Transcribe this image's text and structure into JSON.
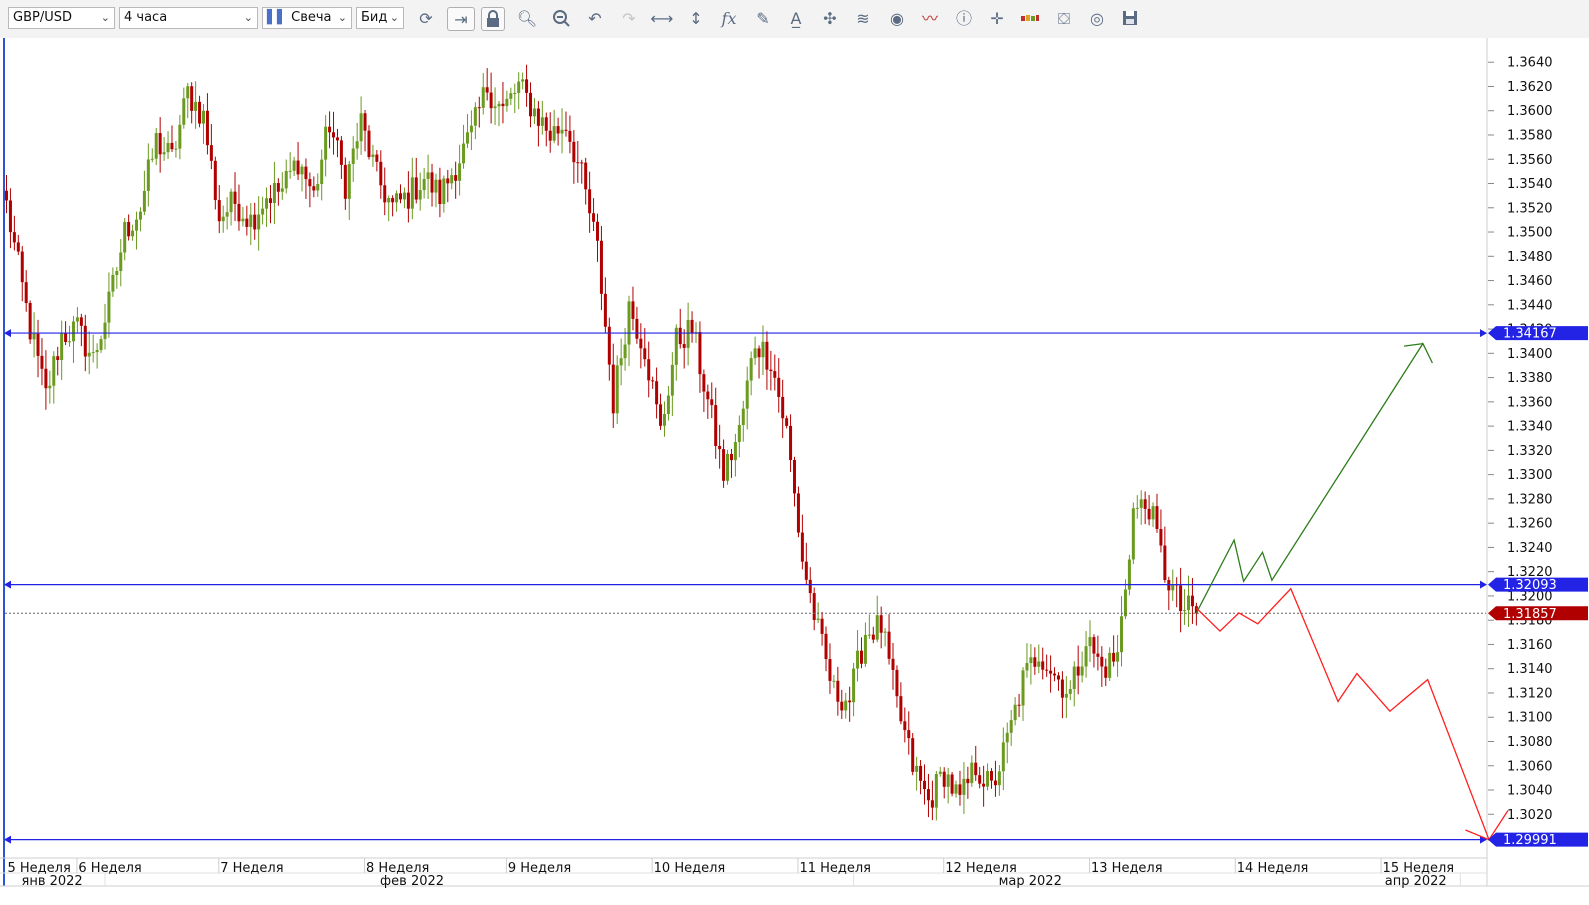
{
  "toolbar": {
    "symbol": "GBP/USD",
    "timeframe": "4 часа",
    "chart_type": "Свеча",
    "price_side": "Бид",
    "icons": [
      "refresh-icon",
      "auto-scroll-icon",
      "lock-icon",
      "zoom-in-icon",
      "zoom-out-icon",
      "undo-icon",
      "redo-icon",
      "horizontal-scale-icon",
      "vertical-scale-icon",
      "indicators-fx-icon",
      "pencil-icon",
      "text-tool-icon",
      "pattern-icon",
      "layers-icon",
      "eye-icon",
      "signals-icon",
      "info-icon",
      "crosshair-icon",
      "volume-bar-icon",
      "paint-bucket-icon",
      "template-icon",
      "save-icon"
    ]
  },
  "colors": {
    "bull": "#6a9a1f",
    "bear": "#b00000",
    "level_line": "#2323e6",
    "green_arrow": "#2e7d1b",
    "red_arrow": "#ff2020",
    "current_price": "#b00000"
  },
  "chart_data": {
    "type": "candlestick",
    "ylim": [
      1.2982,
      1.3655
    ],
    "yticks": [
      1.302,
      1.304,
      1.306,
      1.308,
      1.31,
      1.312,
      1.314,
      1.316,
      1.318,
      1.32,
      1.322,
      1.324,
      1.326,
      1.328,
      1.33,
      1.332,
      1.334,
      1.336,
      1.338,
      1.34,
      1.342,
      1.344,
      1.346,
      1.348,
      1.35,
      1.352,
      1.354,
      1.356,
      1.358,
      1.36,
      1.362,
      1.364
    ],
    "week_labels": [
      "5 Неделя",
      "6 Неделя",
      "7 Неделя",
      "8 Неделя",
      "9 Неделя",
      "10 Неделя",
      "11 Неделя",
      "12 Неделя",
      "13 Неделя",
      "14 Неделя",
      "15 Неделя"
    ],
    "month_labels": [
      "янв 2022",
      "фев 2022",
      "мар 2022",
      "апр 2022"
    ],
    "levels": [
      {
        "label": "1.34167",
        "value": 1.34167
      },
      {
        "label": "1.32093",
        "value": 1.32093
      },
      {
        "label": "1.29991",
        "value": 1.29991
      }
    ],
    "current_price": {
      "label": "1.31857",
      "value": 1.31857
    },
    "anchors": [
      [
        0,
        1.3522
      ],
      [
        6,
        1.342
      ],
      [
        10,
        1.3365
      ],
      [
        14,
        1.3415
      ],
      [
        18,
        1.342
      ],
      [
        22,
        1.3395
      ],
      [
        26,
        1.344
      ],
      [
        30,
        1.35
      ],
      [
        34,
        1.352
      ],
      [
        38,
        1.3575
      ],
      [
        42,
        1.356
      ],
      [
        46,
        1.3615
      ],
      [
        50,
        1.3595
      ],
      [
        54,
        1.3512
      ],
      [
        58,
        1.3525
      ],
      [
        62,
        1.351
      ],
      [
        66,
        1.353
      ],
      [
        70,
        1.3535
      ],
      [
        74,
        1.356
      ],
      [
        78,
        1.353
      ],
      [
        82,
        1.359
      ],
      [
        86,
        1.354
      ],
      [
        90,
        1.359
      ],
      [
        94,
        1.3545
      ],
      [
        98,
        1.352
      ],
      [
        102,
        1.353
      ],
      [
        106,
        1.3545
      ],
      [
        110,
        1.353
      ],
      [
        114,
        1.3555
      ],
      [
        118,
        1.358
      ],
      [
        122,
        1.362
      ],
      [
        126,
        1.36
      ],
      [
        130,
        1.362
      ],
      [
        134,
        1.36
      ],
      [
        138,
        1.358
      ],
      [
        142,
        1.359
      ],
      [
        146,
        1.3545
      ],
      [
        150,
        1.3485
      ],
      [
        154,
        1.336
      ],
      [
        158,
        1.344
      ],
      [
        162,
        1.3405
      ],
      [
        166,
        1.3335
      ],
      [
        170,
        1.341
      ],
      [
        174,
        1.342
      ],
      [
        178,
        1.336
      ],
      [
        182,
        1.33
      ],
      [
        186,
        1.3335
      ],
      [
        190,
        1.341
      ],
      [
        194,
        1.3395
      ],
      [
        198,
        1.3335
      ],
      [
        202,
        1.323
      ],
      [
        206,
        1.317
      ],
      [
        210,
        1.312
      ],
      [
        214,
        1.3115
      ],
      [
        218,
        1.317
      ],
      [
        222,
        1.3175
      ],
      [
        226,
        1.311
      ],
      [
        230,
        1.306
      ],
      [
        234,
        1.303
      ],
      [
        238,
        1.3055
      ],
      [
        242,
        1.303
      ],
      [
        246,
        1.306
      ],
      [
        250,
        1.304
      ],
      [
        254,
        1.308
      ],
      [
        258,
        1.313
      ],
      [
        262,
        1.3155
      ],
      [
        266,
        1.3135
      ],
      [
        270,
        1.312
      ],
      [
        274,
        1.3165
      ],
      [
        278,
        1.314
      ],
      [
        282,
        1.315
      ],
      [
        286,
        1.327
      ],
      [
        290,
        1.3275
      ],
      [
        294,
        1.322
      ],
      [
        298,
        1.319
      ],
      [
        302,
        1.3186
      ]
    ],
    "green_path": [
      [
        1.3186,
        0
      ],
      [
        1.3246,
        8
      ],
      [
        1.3212,
        10
      ],
      [
        1.3236,
        14
      ],
      [
        1.3213,
        16
      ],
      [
        1.3408,
        48
      ],
      [
        1.3392,
        50
      ]
    ],
    "green_head": [
      [
        1.3406,
        44
      ]
    ],
    "red_path": [
      [
        1.319,
        0
      ],
      [
        1.3171,
        5
      ],
      [
        1.3186,
        9
      ],
      [
        1.3177,
        13
      ],
      [
        1.3206,
        20
      ],
      [
        1.3113,
        30
      ],
      [
        1.3136,
        34
      ],
      [
        1.3105,
        41
      ],
      [
        1.3131,
        49
      ],
      [
        1.2999,
        62
      ],
      [
        1.3023,
        66
      ]
    ],
    "red_head": [
      [
        1.3007,
        57
      ]
    ]
  }
}
